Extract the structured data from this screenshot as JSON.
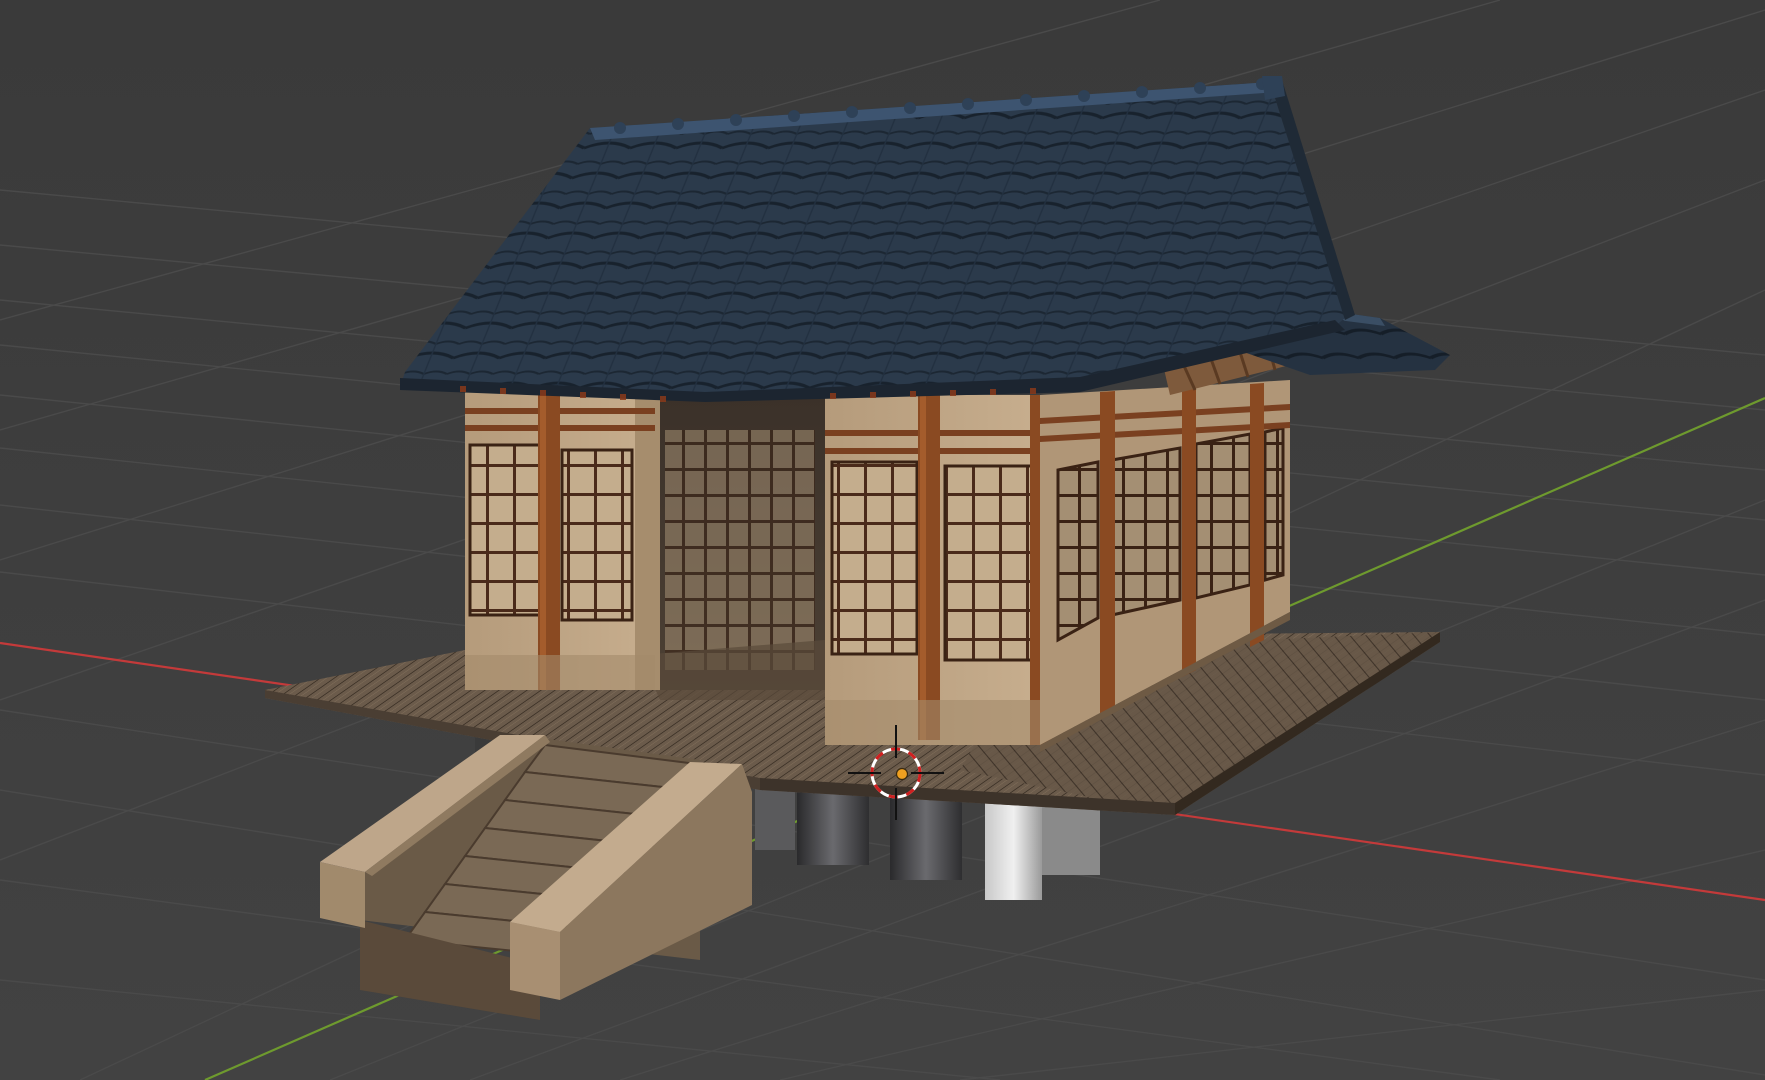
{
  "app": {
    "editor": "3d-viewport",
    "view": "perspective",
    "shading": "material-preview"
  },
  "scene": {
    "object_description": "japanese-shrine-model",
    "roof_style": "tiled-gable",
    "has_stairs": true,
    "has_wooden_deck": true
  },
  "overlays": {
    "grid_floor": true,
    "x_axis": true,
    "y_axis": true,
    "z_axis": false
  },
  "colors": {
    "background": "#3d3d3d",
    "grid": "#4a4a4a",
    "x_axis": "#c43a3a",
    "y_axis": "#6e9a2e",
    "roof": "#283646",
    "wall": "#bba181",
    "timber": "#8a4a22",
    "deck": "#6a5a4a",
    "cursor_ring": "#d02020",
    "origin": "#f0a020"
  },
  "icons": {
    "cursor": "3d-cursor-icon",
    "origin": "object-origin-icon"
  }
}
